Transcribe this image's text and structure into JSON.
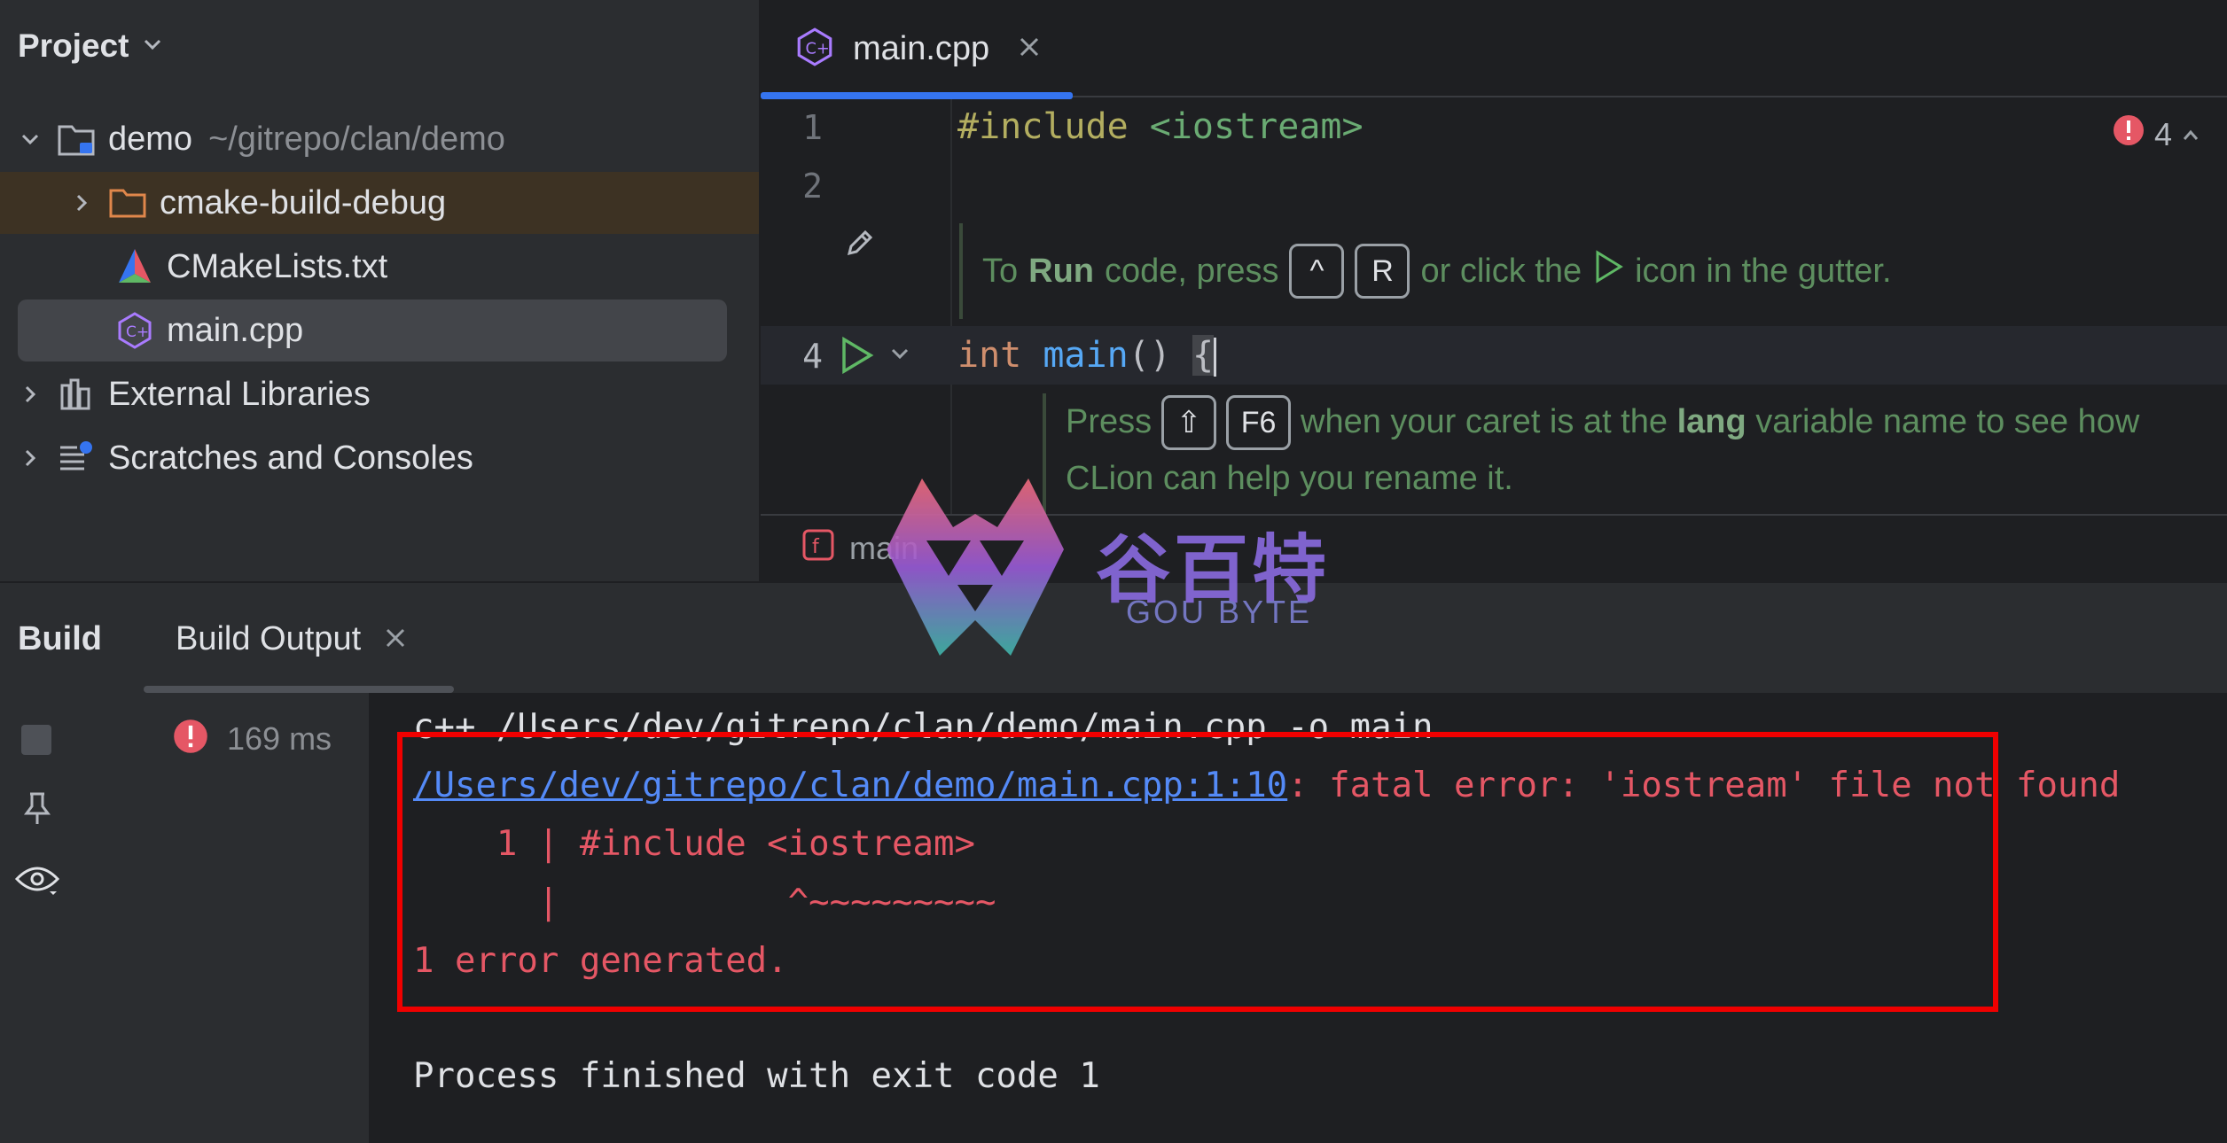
{
  "project": {
    "title": "Project",
    "tree": [
      {
        "label": "demo",
        "path": "~/gitrepo/clan/demo"
      },
      {
        "label": "cmake-build-debug"
      },
      {
        "label": "CMakeLists.txt"
      },
      {
        "label": "main.cpp"
      },
      {
        "label": "External Libraries"
      },
      {
        "label": "Scratches and Consoles"
      }
    ]
  },
  "editor": {
    "tab_label": "main.cpp",
    "error_count": "4",
    "line_numbers": [
      "1",
      "2",
      "4"
    ],
    "line1": {
      "directive": "#include",
      "header": "<iostream>"
    },
    "line4": {
      "kw": "int",
      "fn": "main",
      "parens": "()",
      "brace": "{"
    },
    "hint_run": {
      "prefix": "To",
      "bold": "Run",
      "mid": "code, press",
      "key1": "^",
      "key2": "R",
      "suffix1": "or click the",
      "suffix2": "icon in the gutter."
    },
    "hint_rename": {
      "prefix": "Press",
      "key1": "⇧",
      "key2": "F6",
      "mid": "when your caret is at the",
      "bold": "lang",
      "suffix": "variable name to see how CLion can help you rename it."
    },
    "breadcrumb": "main"
  },
  "build": {
    "title": "Build",
    "tab_label": "Build Output",
    "duration": "169 ms",
    "console": {
      "cmd": "c++ /Users/dev/gitrepo/clan/demo/main.cpp -o main",
      "err_link": "/Users/dev/gitrepo/clan/demo/main.cpp:1:10",
      "err_msg": ": fatal error: 'iostream' file not found",
      "src_line": "    1 | #include <iostream>",
      "caret_line": "      |           ^~~~~~~~~~",
      "summary": "1 error generated.",
      "exit": "Process finished with exit code 1"
    }
  },
  "watermark": {
    "cn": "谷百特",
    "en": "GOU BYTE"
  },
  "colors": {
    "accent": "#3574f0",
    "error": "#e55765",
    "hint_green": "#5d8e5f",
    "highlight_box": "#f00000"
  }
}
